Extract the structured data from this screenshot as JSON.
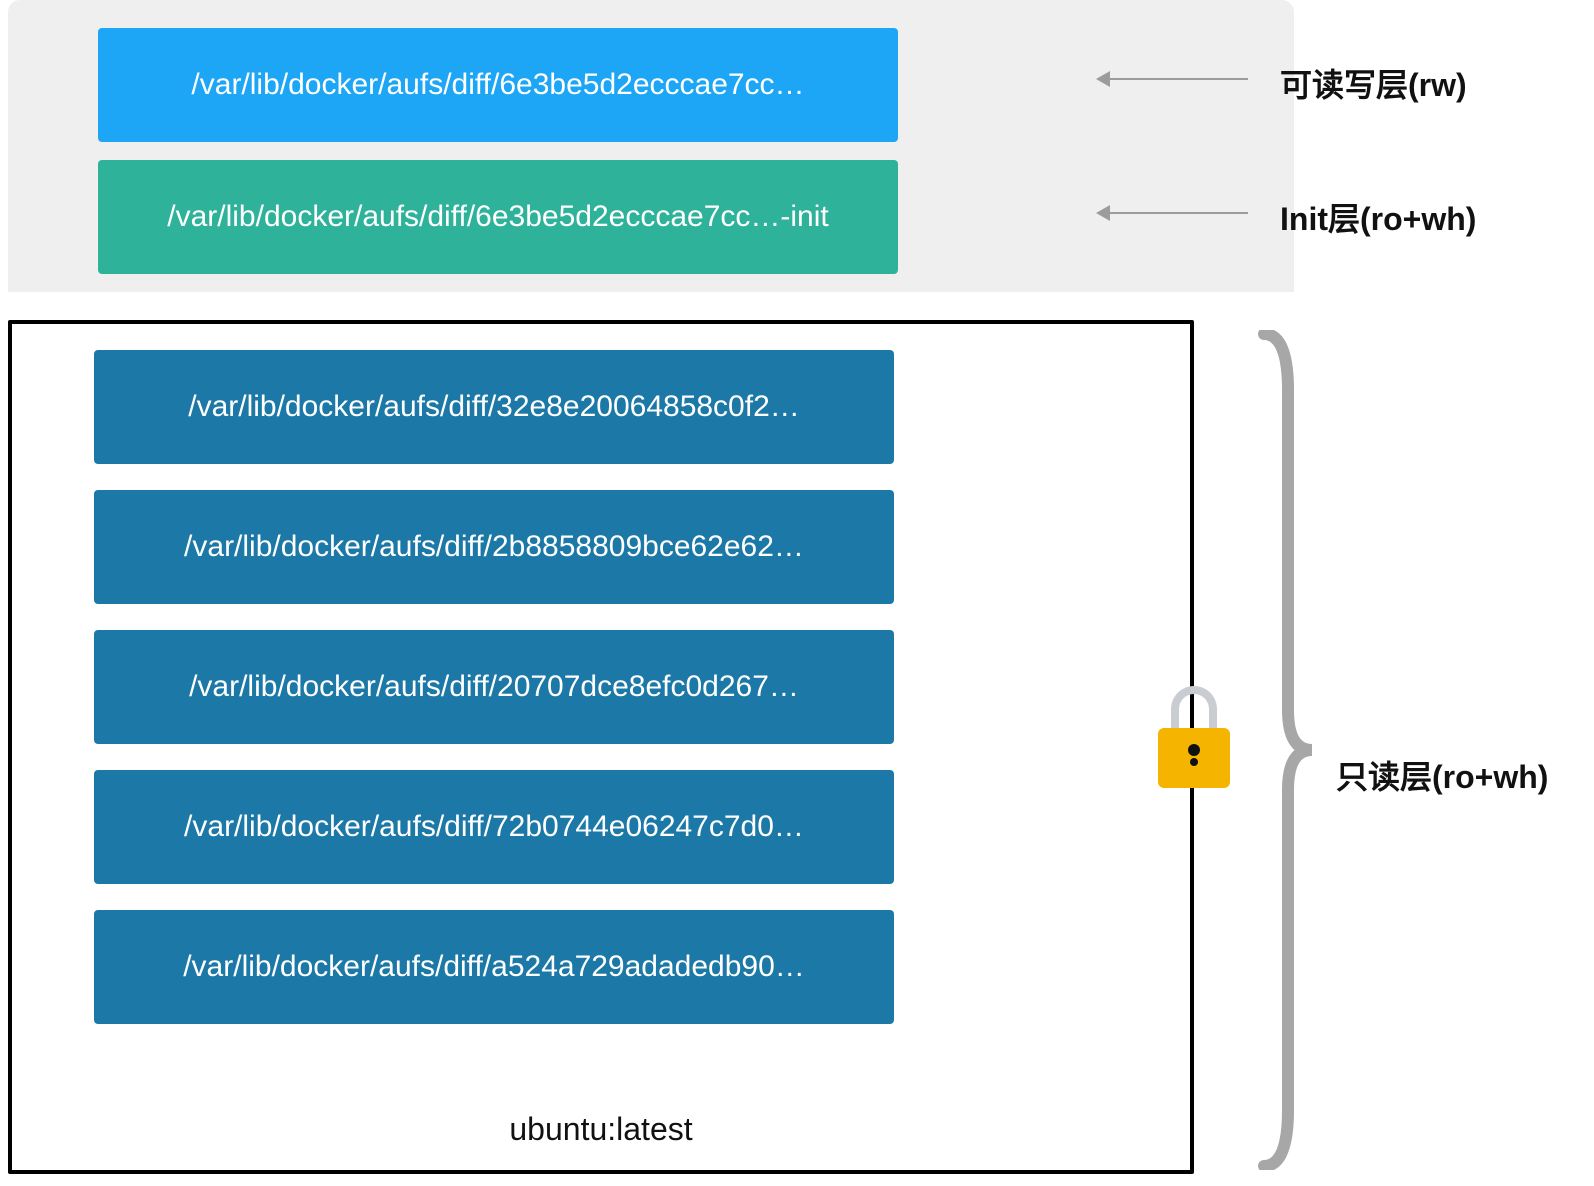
{
  "rw_layer": {
    "path": "/var/lib/docker/aufs/diff/6e3be5d2ecccae7cc…",
    "label": "可读写层(rw)"
  },
  "init_layer": {
    "path": "/var/lib/docker/aufs/diff/6e3be5d2ecccae7cc…-init",
    "label": "Init层(ro+wh)"
  },
  "readonly": {
    "label": "只读层(ro+wh)",
    "image_tag": "ubuntu:latest",
    "layers": [
      "/var/lib/docker/aufs/diff/32e8e20064858c0f2…",
      "/var/lib/docker/aufs/diff/2b8858809bce62e62…",
      "/var/lib/docker/aufs/diff/20707dce8efc0d267…",
      "/var/lib/docker/aufs/diff/72b0744e06247c7d0…",
      "/var/lib/docker/aufs/diff/a524a729adadedb90…"
    ]
  }
}
